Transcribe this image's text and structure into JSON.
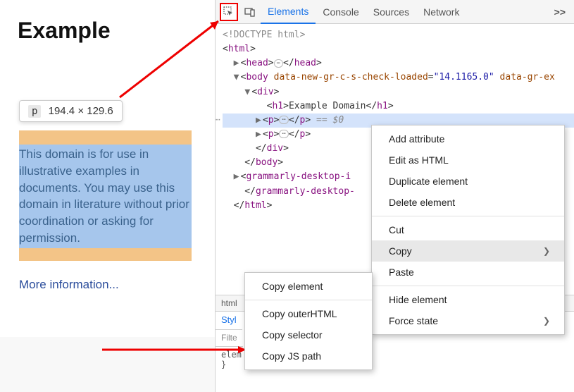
{
  "page": {
    "title": "Example",
    "tooltip_tag": "p",
    "tooltip_dims": "194.4 × 129.6",
    "paragraph": "This domain is for use in illustrative examples in documents. You may use this domain in literature without prior coordination or asking for permission.",
    "more_link": "More information..."
  },
  "toolbar": {
    "tabs": [
      "Elements",
      "Console",
      "Sources",
      "Network"
    ],
    "active": 0,
    "overflow": ">>"
  },
  "dom": {
    "doctype": "<!DOCTYPE html>",
    "html_open": "html",
    "head": "head",
    "body_attr_name": "data-new-gr-c-s-check-loaded",
    "body_attr_val": "14.1165.0",
    "body_attr2_name": "data-gr-ex",
    "div": "div",
    "h1_text": "Example Domain",
    "p": "p",
    "szero": "== $0",
    "grammarly": "grammarly-desktop-i",
    "grammarly2": "grammarly-desktop-"
  },
  "breadcrumb": "html",
  "styles_tab": "Styl",
  "filter": "Filte",
  "rule_sel": "elem",
  "rule_brace": "}",
  "context_menu_1": {
    "items": [
      {
        "label": "Add attribute"
      },
      {
        "label": "Edit as HTML"
      },
      {
        "label": "Duplicate element"
      },
      {
        "label": "Delete element"
      }
    ],
    "items2": [
      {
        "label": "Cut"
      },
      {
        "label": "Copy",
        "submenu": true,
        "hover": true
      },
      {
        "label": "Paste"
      }
    ],
    "items3": [
      {
        "label": "Hide element"
      },
      {
        "label": "Force state",
        "submenu": true
      }
    ]
  },
  "context_menu_2": {
    "items": [
      {
        "label": "Copy element"
      }
    ],
    "items2": [
      {
        "label": "Copy outerHTML"
      },
      {
        "label": "Copy selector"
      },
      {
        "label": "Copy JS path"
      }
    ]
  }
}
